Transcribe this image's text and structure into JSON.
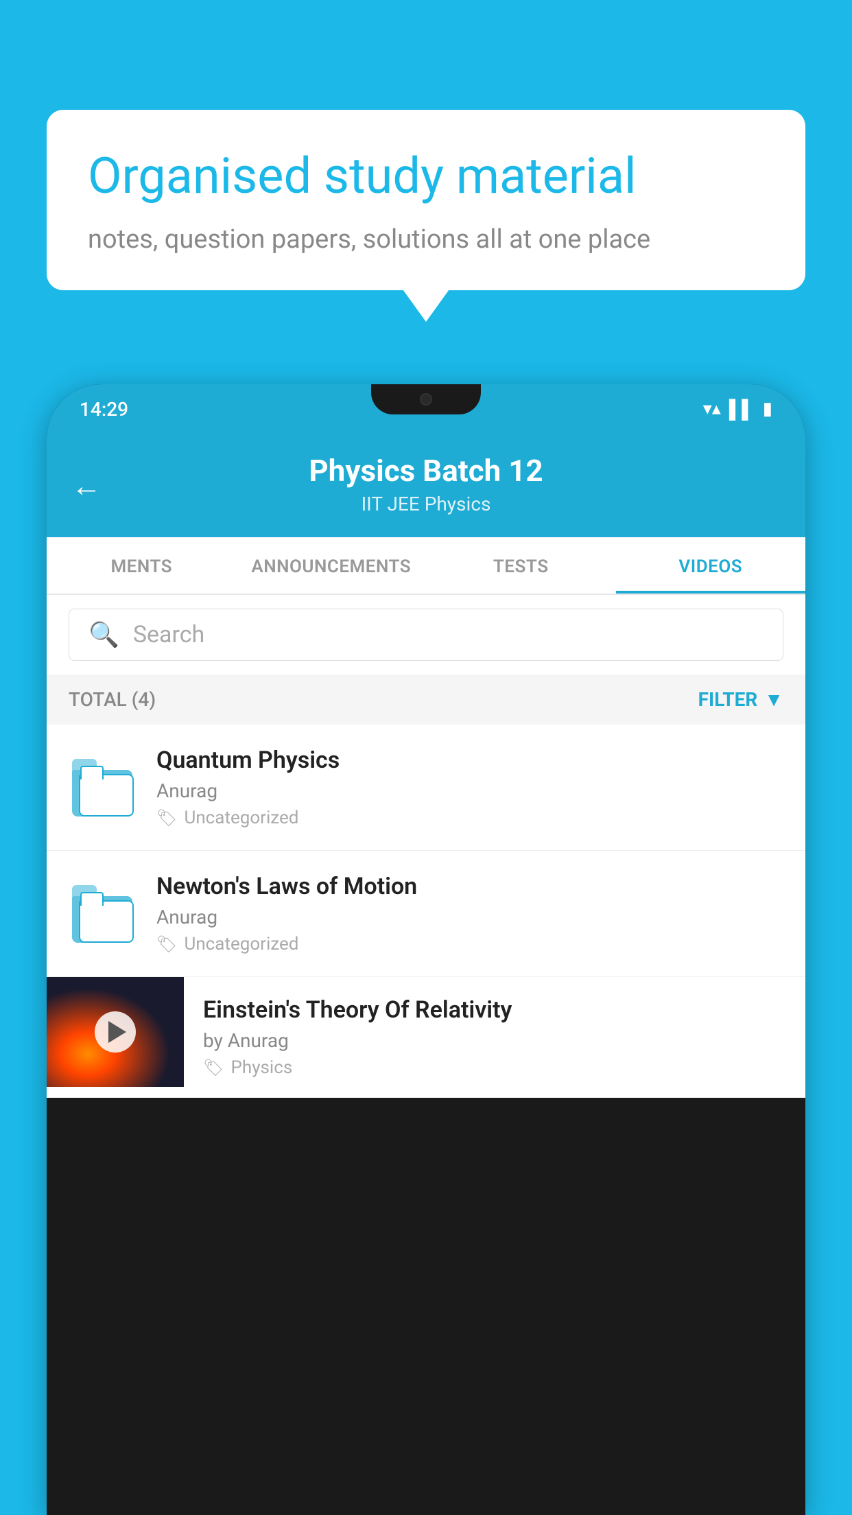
{
  "page": {
    "background_color": "#1BB8E8"
  },
  "speech_bubble": {
    "title": "Organised study material",
    "subtitle": "notes, question papers, solutions all at one place"
  },
  "status_bar": {
    "time": "14:29"
  },
  "app_header": {
    "back_label": "←",
    "title": "Physics Batch 12",
    "subtitle": "IIT JEE   Physics"
  },
  "tabs": [
    {
      "label": "MENTS",
      "active": false
    },
    {
      "label": "ANNOUNCEMENTS",
      "active": false
    },
    {
      "label": "TESTS",
      "active": false
    },
    {
      "label": "VIDEOS",
      "active": true
    }
  ],
  "search": {
    "placeholder": "Search"
  },
  "filter_bar": {
    "total_label": "TOTAL (4)",
    "filter_label": "FILTER"
  },
  "video_items": [
    {
      "type": "folder",
      "title": "Quantum Physics",
      "author": "Anurag",
      "tag": "Uncategorized"
    },
    {
      "type": "folder",
      "title": "Newton's Laws of Motion",
      "author": "Anurag",
      "tag": "Uncategorized"
    },
    {
      "type": "video",
      "title": "Einstein's Theory Of Relativity",
      "author": "by Anurag",
      "tag": "Physics"
    }
  ]
}
